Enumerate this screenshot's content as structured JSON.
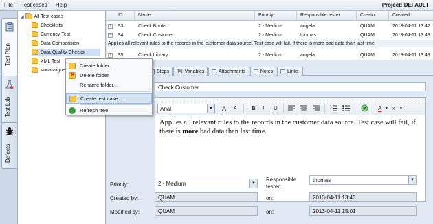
{
  "menubar": {
    "items": [
      "File",
      "Test cases",
      "Help"
    ],
    "project": "Project: DEFAULT"
  },
  "vtabs": [
    {
      "label": "Test Plan",
      "icon": "clipboard-icon"
    },
    {
      "label": "Test Lab",
      "icon": "flask-icon"
    },
    {
      "label": "Defects",
      "icon": "bug-icon"
    }
  ],
  "tree": {
    "root": "All Test cases",
    "items": [
      "Checklists",
      "Currency Test",
      "Data Comparision",
      "Data Quality Checks",
      "XML Test",
      "<unassigned"
    ]
  },
  "grid": {
    "headers": [
      "ID",
      "Name",
      "Priority",
      "Responsible tester",
      "Creator",
      "Created"
    ],
    "rows": [
      {
        "id": "S3",
        "name": "Check Books",
        "priority": "2 - Medium",
        "tester": "angela",
        "creator": "QUAM",
        "created": "2013-04-11 13:42"
      },
      {
        "id": "S4",
        "name": "Check Customer",
        "priority": "2 - Medium",
        "tester": "thomas",
        "creator": "QUAM",
        "created": "2013-04-11 13:43"
      },
      {
        "id": "S5",
        "name": "Check Library",
        "priority": "2 - Medium",
        "tester": "angela",
        "creator": "QUAM",
        "created": "2013-04-11 13:43"
      }
    ],
    "s4_description": "Applies all relevant rules to the records in the customer data source.  Test case will fail, if there is more bad data than last time."
  },
  "detail": {
    "tabs": [
      "Steps",
      "Variables",
      "Attachments",
      "Notes",
      "Links"
    ],
    "tab_prefix": "f(x)",
    "name_value": "Check Customer",
    "font_value": "Arial",
    "toolbar": {
      "grow": "A",
      "shrink": "A",
      "bold": "B",
      "italic": "I",
      "underline": "U",
      "more": "»"
    },
    "body_before": "Applies all relevant rules to the records in the customer data source.  Test case will fail, if there is ",
    "body_bold": "more",
    "body_after": " bad data than last time.",
    "priority_label": "Priority:",
    "priority_value": "2 - Medium",
    "responsible_label_1": "Responsible",
    "responsible_label_2": "tester:",
    "responsible_value": "thomas",
    "created_by_label": "Created by:",
    "created_by_value": "QUAM",
    "on_label": "on:",
    "created_on_value": "2013-04-11 13:43",
    "modified_by_label": "Modified by:",
    "modified_by_value": "QUAM",
    "modified_on_value": "2013-04-11 15:01"
  },
  "context_menu": {
    "items": [
      "Create folder...",
      "Delete folder",
      "Rename folder...",
      "Create test case...",
      "Refresh tree"
    ],
    "highlighted": "Create test case..."
  },
  "colors": {
    "accent": "#d6e4f6",
    "folder": "#f1c64a",
    "font_color_bar": "#d02020"
  }
}
